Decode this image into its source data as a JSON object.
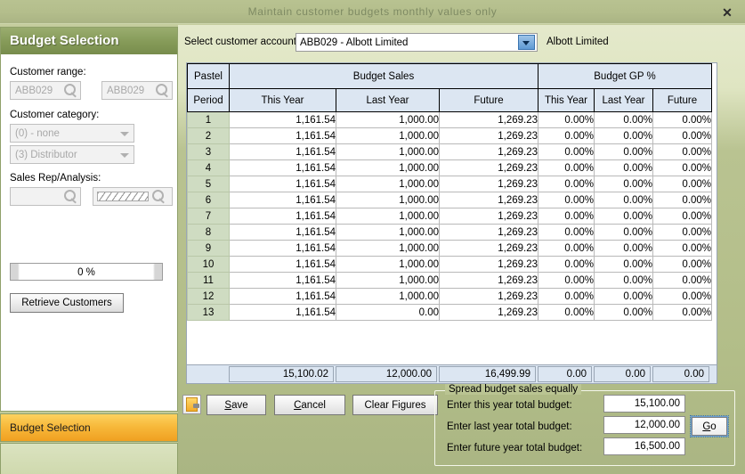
{
  "window": {
    "title": "Maintain customer budgets monthly values only",
    "close_label": "✕"
  },
  "sidebar": {
    "header": "Budget Selection",
    "customer_range": {
      "label": "Customer range:",
      "from": "ABB029",
      "to": "ABB029"
    },
    "customer_category": {
      "label": "Customer category:",
      "option1": "(0) - none",
      "option2": "(3) Distributor"
    },
    "sales_rep": {
      "label": "Sales Rep/Analysis:",
      "field1": "",
      "field2": ""
    },
    "progress": "0 %",
    "retrieve_button": "Retrieve Customers"
  },
  "nav": {
    "selected_item": "Budget Selection"
  },
  "account": {
    "label": "Select customer account:",
    "value": "ABB029 - Albott Limited",
    "name": "Albott Limited"
  },
  "grid": {
    "group_headers": {
      "period": "Pastel",
      "sales": "Budget Sales",
      "gp": "Budget GP %"
    },
    "sub_headers": {
      "period": "Period",
      "sales_this_year": "This Year",
      "sales_last_year": "Last Year",
      "sales_future": "Future",
      "gp_this_year": "This Year",
      "gp_last_year": "Last Year",
      "gp_future": "Future"
    },
    "rows": [
      {
        "period": "1",
        "sales_this_year": "1,161.54",
        "sales_last_year": "1,000.00",
        "sales_future": "1,269.23",
        "gp_this_year": "0.00%",
        "gp_last_year": "0.00%",
        "gp_future": "0.00%"
      },
      {
        "period": "2",
        "sales_this_year": "1,161.54",
        "sales_last_year": "1,000.00",
        "sales_future": "1,269.23",
        "gp_this_year": "0.00%",
        "gp_last_year": "0.00%",
        "gp_future": "0.00%"
      },
      {
        "period": "3",
        "sales_this_year": "1,161.54",
        "sales_last_year": "1,000.00",
        "sales_future": "1,269.23",
        "gp_this_year": "0.00%",
        "gp_last_year": "0.00%",
        "gp_future": "0.00%"
      },
      {
        "period": "4",
        "sales_this_year": "1,161.54",
        "sales_last_year": "1,000.00",
        "sales_future": "1,269.23",
        "gp_this_year": "0.00%",
        "gp_last_year": "0.00%",
        "gp_future": "0.00%"
      },
      {
        "period": "5",
        "sales_this_year": "1,161.54",
        "sales_last_year": "1,000.00",
        "sales_future": "1,269.23",
        "gp_this_year": "0.00%",
        "gp_last_year": "0.00%",
        "gp_future": "0.00%"
      },
      {
        "period": "6",
        "sales_this_year": "1,161.54",
        "sales_last_year": "1,000.00",
        "sales_future": "1,269.23",
        "gp_this_year": "0.00%",
        "gp_last_year": "0.00%",
        "gp_future": "0.00%"
      },
      {
        "period": "7",
        "sales_this_year": "1,161.54",
        "sales_last_year": "1,000.00",
        "sales_future": "1,269.23",
        "gp_this_year": "0.00%",
        "gp_last_year": "0.00%",
        "gp_future": "0.00%"
      },
      {
        "period": "8",
        "sales_this_year": "1,161.54",
        "sales_last_year": "1,000.00",
        "sales_future": "1,269.23",
        "gp_this_year": "0.00%",
        "gp_last_year": "0.00%",
        "gp_future": "0.00%"
      },
      {
        "period": "9",
        "sales_this_year": "1,161.54",
        "sales_last_year": "1,000.00",
        "sales_future": "1,269.23",
        "gp_this_year": "0.00%",
        "gp_last_year": "0.00%",
        "gp_future": "0.00%"
      },
      {
        "period": "10",
        "sales_this_year": "1,161.54",
        "sales_last_year": "1,000.00",
        "sales_future": "1,269.23",
        "gp_this_year": "0.00%",
        "gp_last_year": "0.00%",
        "gp_future": "0.00%"
      },
      {
        "period": "11",
        "sales_this_year": "1,161.54",
        "sales_last_year": "1,000.00",
        "sales_future": "1,269.23",
        "gp_this_year": "0.00%",
        "gp_last_year": "0.00%",
        "gp_future": "0.00%"
      },
      {
        "period": "12",
        "sales_this_year": "1,161.54",
        "sales_last_year": "1,000.00",
        "sales_future": "1,269.23",
        "gp_this_year": "0.00%",
        "gp_last_year": "0.00%",
        "gp_future": "0.00%"
      },
      {
        "period": "13",
        "sales_this_year": "1,161.54",
        "sales_last_year": "0.00",
        "sales_future": "1,269.23",
        "gp_this_year": "0.00%",
        "gp_last_year": "0.00%",
        "gp_future": "0.00%"
      }
    ],
    "totals": {
      "sales_this_year": "15,100.02",
      "sales_last_year": "12,000.00",
      "sales_future": "16,499.99",
      "gp_this_year": "0.00",
      "gp_last_year": "0.00",
      "gp_future": "0.00"
    }
  },
  "actions": {
    "save": "Save",
    "save_accel": "S",
    "save_rest": "ave",
    "cancel_accel": "C",
    "cancel_rest": "ancel",
    "clear_figures": "Clear Figures"
  },
  "spread": {
    "legend": "Spread budget sales equally",
    "this_year_label": "Enter this year total budget:",
    "this_year_value": "15,100.00",
    "last_year_label": "Enter last year total budget:",
    "last_year_value": "12,000.00",
    "future_year_label": "Enter future year total budget:",
    "future_year_value": "16,500.00",
    "go_accel": "G",
    "go_rest": "o"
  }
}
